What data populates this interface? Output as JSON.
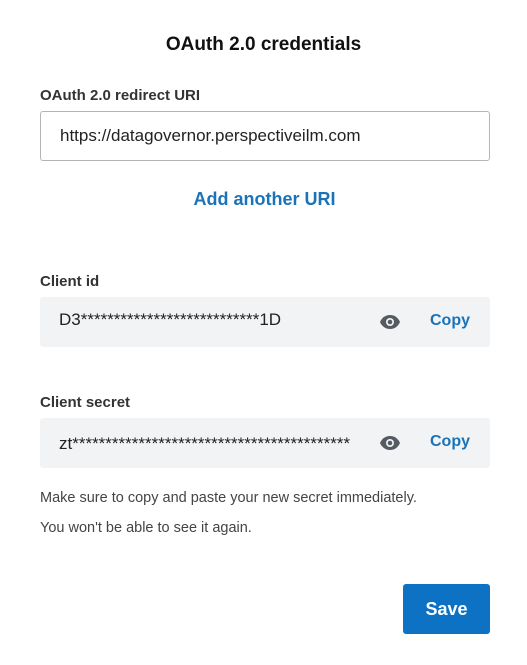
{
  "dialog": {
    "title": "OAuth 2.0 credentials"
  },
  "redirect_uri": {
    "label": "OAuth 2.0 redirect URI",
    "value": "https://datagovernor.perspectiveilm.com",
    "add_link": "Add another URI"
  },
  "client_id": {
    "label": "Client id",
    "value": "D3***************************1D",
    "reveal_icon": "eye-icon",
    "copy_label": "Copy"
  },
  "client_secret": {
    "label": "Client secret",
    "value": "zt******************************************",
    "reveal_icon": "eye-icon",
    "copy_label": "Copy"
  },
  "notes": {
    "line1": "Make sure to copy and paste your new secret immediately.",
    "line2": "You won't be able to see it again."
  },
  "footer": {
    "save_label": "Save"
  },
  "colors": {
    "accent": "#1a73b8",
    "primary_button": "#0d72c4",
    "field_background": "#f2f3f5",
    "icon": "#555b62"
  }
}
